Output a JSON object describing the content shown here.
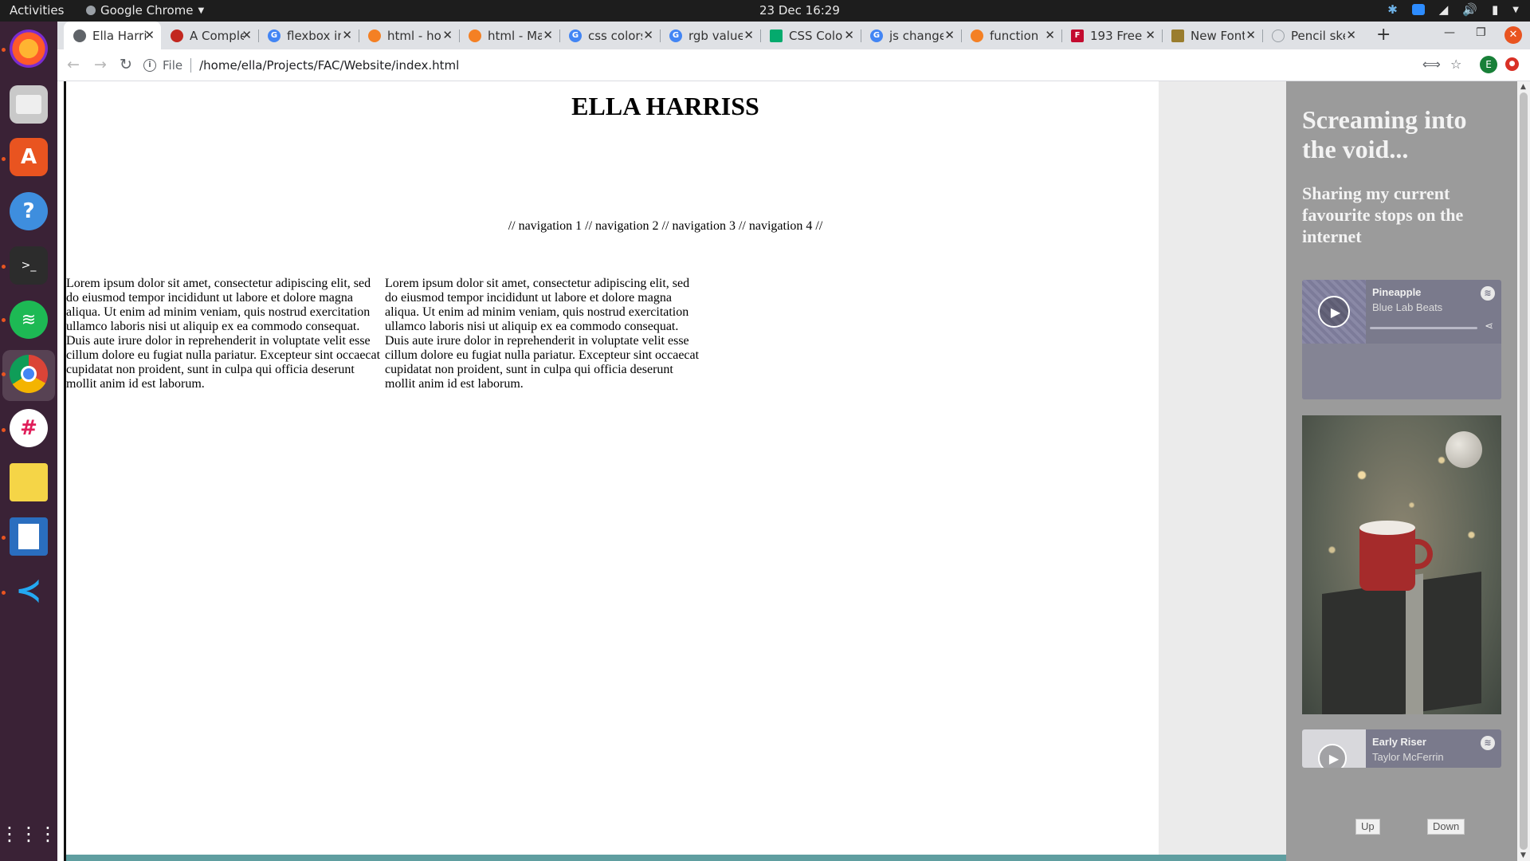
{
  "topbar": {
    "activities": "Activities",
    "app_name": "Google Chrome",
    "clock": "23 Dec  16:29"
  },
  "dock": {
    "items": [
      "Firefox",
      "Files",
      "Ubuntu Software",
      "Help",
      "Terminal",
      "Spotify",
      "Google Chrome",
      "Slack",
      "Notes",
      "LibreOffice Writer",
      "Visual Studio Code",
      "Show Applications"
    ]
  },
  "browser": {
    "tabs": [
      {
        "title": "Ella Harriss",
        "favicon_color": "#5f6368"
      },
      {
        "title": "A Complete Guide",
        "favicon_color": "#c2271f"
      },
      {
        "title": "flexbox in css",
        "favicon_color": "#4285f4"
      },
      {
        "title": "html - how",
        "favicon_color": "#f48024"
      },
      {
        "title": "html - Make",
        "favicon_color": "#f48024"
      },
      {
        "title": "css colors",
        "favicon_color": "#4285f4"
      },
      {
        "title": "rgb value",
        "favicon_color": "#4285f4"
      },
      {
        "title": "CSS Colors",
        "favicon_color": "#04aa6d"
      },
      {
        "title": "js change",
        "favicon_color": "#4285f4"
      },
      {
        "title": "function",
        "favicon_color": "#f48024"
      },
      {
        "title": "193 Free",
        "favicon_color": "#c30b2f"
      },
      {
        "title": "New Fonts",
        "favicon_color": "#9a7d2e"
      },
      {
        "title": "Pencil sketch",
        "favicon_color": "#9aa0a6"
      }
    ],
    "scheme_label": "File",
    "url": "/home/ella/Projects/FAC/Website/index.html",
    "profile_initial": "E"
  },
  "page": {
    "title": "ELLA HARRISS",
    "nav": "// navigation 1 // navigation 2 // navigation 3 // navigation 4 //",
    "columns": [
      "Lorem ipsum dolor sit amet, consectetur adipiscing elit, sed do eiusmod tempor incididunt ut labore et dolore magna aliqua. Ut enim ad minim veniam, quis nostrud exercitation ullamco laboris nisi ut aliquip ex ea commodo consequat. Duis aute irure dolor in reprehenderit in voluptate velit esse cillum dolore eu fugiat nulla pariatur. Excepteur sint occaecat cupidatat non proident, sunt in culpa qui officia deserunt mollit anim id est laborum.",
      "Lorem ipsum dolor sit amet, consectetur adipiscing elit, sed do eiusmod tempor incididunt ut labore et dolore magna aliqua. Ut enim ad minim veniam, quis nostrud exercitation ullamco laboris nisi ut aliquip ex ea commodo consequat. Duis aute irure dolor in reprehenderit in voluptate velit esse cillum dolore eu fugiat nulla pariatur. Excepteur sint occaecat cupidatat non proident, sunt in culpa qui officia deserunt mollit anim id est laborum."
    ],
    "sidebar": {
      "heading": "Screaming into the void...",
      "subheading": "Sharing my current favourite stops on the internet",
      "tracks": [
        {
          "title": "Pineapple",
          "artist": "Blue Lab Beats"
        },
        {
          "title": "Early Riser",
          "artist": "Taylor McFerrin"
        }
      ],
      "up_label": "Up",
      "down_label": "Down"
    }
  }
}
